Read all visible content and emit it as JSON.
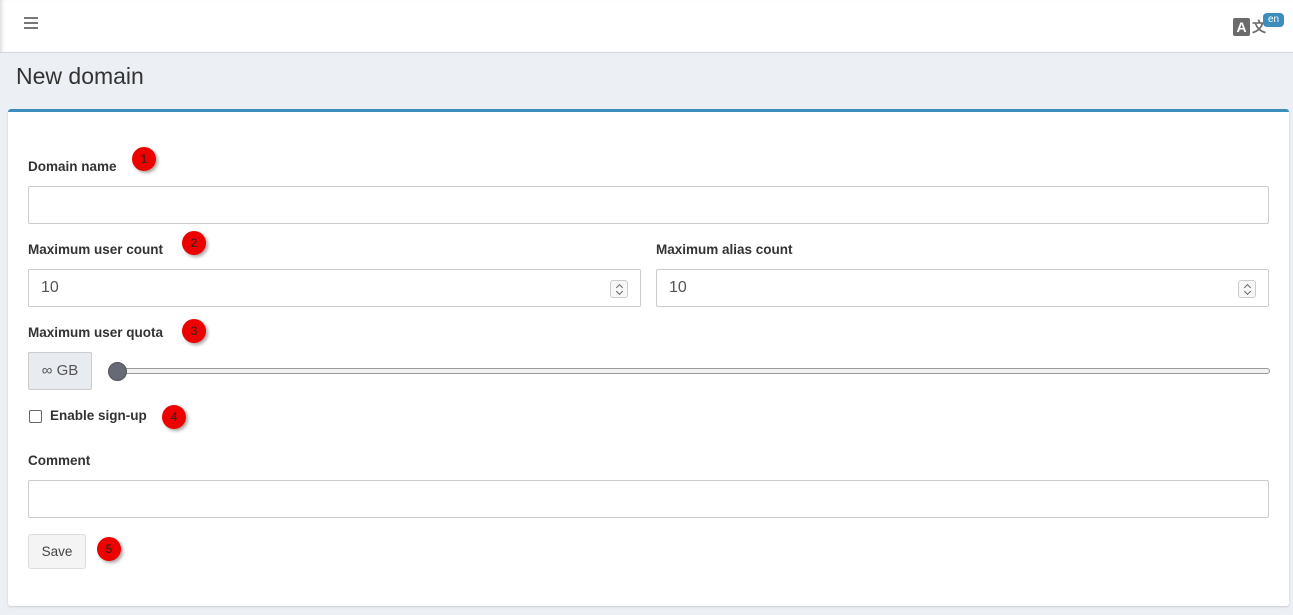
{
  "header": {
    "menu_icon": "hamburger-icon",
    "language": {
      "icon": "translate-icon",
      "glyph_a": "A",
      "glyph_b": "文",
      "badge": "en"
    }
  },
  "page": {
    "title": "New domain"
  },
  "form": {
    "domain_name": {
      "label": "Domain name",
      "value": ""
    },
    "max_user_count": {
      "label": "Maximum user count",
      "value": "10"
    },
    "max_alias_count": {
      "label": "Maximum alias count",
      "value": "10"
    },
    "max_user_quota": {
      "label": "Maximum user quota",
      "addon": "∞ GB",
      "slider_value_fraction": 0
    },
    "enable_signup": {
      "label": "Enable sign-up",
      "checked": false
    },
    "comment": {
      "label": "Comment",
      "value": ""
    },
    "save_label": "Save"
  },
  "annotations": [
    "1",
    "2",
    "3",
    "4",
    "5"
  ],
  "colors": {
    "accent": "#3c8dbc",
    "marker": "#ee0000",
    "background": "#ecf0f5"
  }
}
